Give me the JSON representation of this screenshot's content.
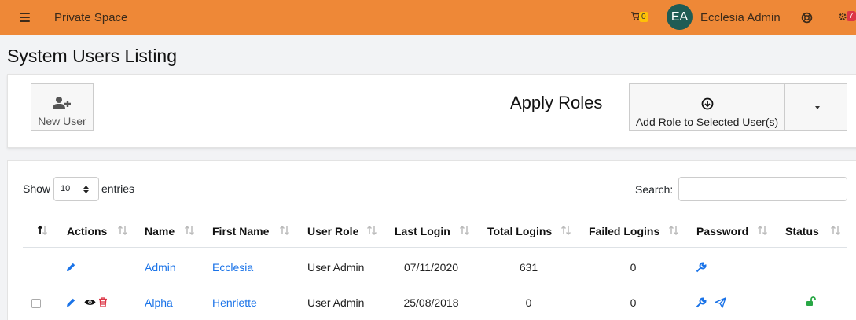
{
  "topbar": {
    "brand": "Private Space",
    "cart_count": "0",
    "avatar_initials": "EA",
    "user_name": "Ecclesia Admin",
    "settings_count": "7"
  },
  "page_title": "System Users Listing",
  "actions": {
    "new_user_label": "New User",
    "apply_roles_title": "Apply Roles",
    "add_role_label": "Add Role to Selected User(s)"
  },
  "table_controls": {
    "show_label": "Show",
    "entries_value": "10",
    "entries_label": "entries",
    "search_label": "Search:",
    "search_value": ""
  },
  "columns": [
    "Actions",
    "Name",
    "First Name",
    "User Role",
    "Last Login",
    "Total Logins",
    "Failed Logins",
    "Password",
    "Status"
  ],
  "rows": [
    {
      "name": "Admin",
      "first_name": "Ecclesia",
      "user_role": "User Admin",
      "last_login": "07/11/2020",
      "total_logins": "631",
      "failed_logins": "0"
    },
    {
      "name": "Alpha",
      "first_name": "Henriette",
      "user_role": "User Admin",
      "last_login": "25/08/2018",
      "total_logins": "0",
      "failed_logins": "0"
    }
  ],
  "colors": {
    "topbar": "#ee8837",
    "link": "#1a73e8",
    "delete": "#dc3545",
    "unlock": "#28a745"
  }
}
